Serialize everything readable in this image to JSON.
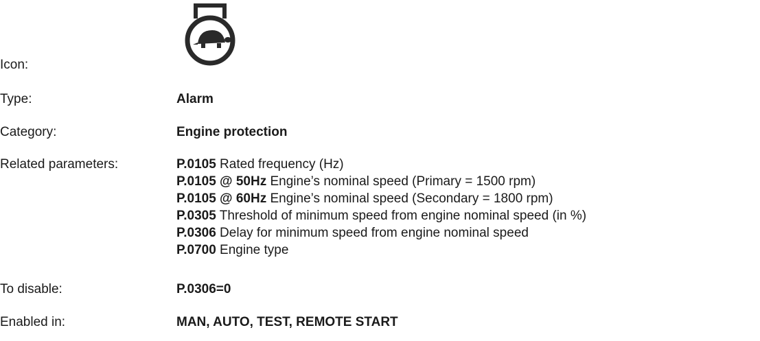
{
  "icon_row": {
    "label": "Icon:",
    "icon_name": "engine-low-speed-turtle-icon"
  },
  "type_row": {
    "label": "Type:",
    "value": "Alarm"
  },
  "category_row": {
    "label": "Category:",
    "value": "Engine protection"
  },
  "related_row": {
    "label": "Related parameters:",
    "items": [
      {
        "code": "P.0105",
        "text": " Rated frequency (Hz)"
      },
      {
        "code": "P.0105 @ 50Hz",
        "text": " Engine’s nominal speed (Primary = 1500 rpm)"
      },
      {
        "code": "P.0105 @ 60Hz",
        "text": " Engine’s nominal speed (Secondary = 1800 rpm)"
      },
      {
        "code": "P.0305",
        "text": " Threshold of minimum speed from engine nominal speed (in %)"
      },
      {
        "code": "P.0306",
        "text": " Delay for minimum speed from engine nominal speed"
      },
      {
        "code": "P.0700",
        "text": " Engine type"
      }
    ]
  },
  "disable_row": {
    "label": "To disable:",
    "value": "P.0306=0"
  },
  "enabled_row": {
    "label": "Enabled in:",
    "value": "MAN, AUTO, TEST, REMOTE START"
  }
}
